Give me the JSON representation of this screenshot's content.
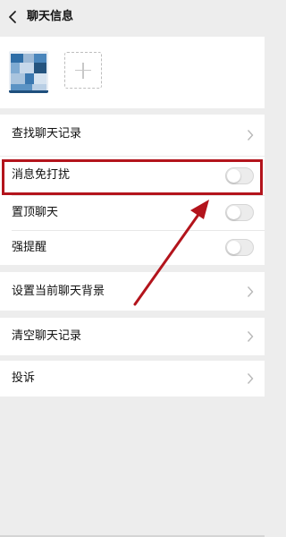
{
  "header": {
    "title": "聊天信息"
  },
  "icons": {
    "back": "chevron-left-icon",
    "add_member": "plus-icon",
    "chevron": "chevron-right-icon",
    "annotation": "red-arrow-icon"
  },
  "sections": {
    "search": {
      "label": "查找聊天记录"
    },
    "toggles": [
      {
        "label": "消息免打扰",
        "on": false
      },
      {
        "label": "置顶聊天",
        "on": false
      },
      {
        "label": "强提醒",
        "on": false
      }
    ],
    "background": {
      "label": "设置当前聊天背景"
    },
    "clear": {
      "label": "清空聊天记录"
    },
    "report": {
      "label": "投诉"
    }
  },
  "colors": {
    "highlight": "#b3141c",
    "page_bg": "#ededed",
    "toggle_off": "#ececec"
  }
}
